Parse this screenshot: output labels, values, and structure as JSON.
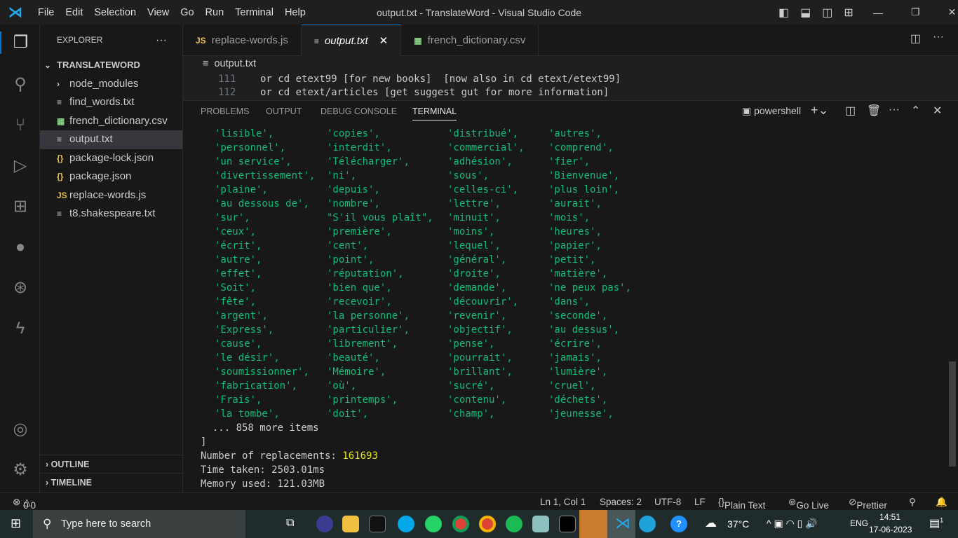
{
  "titlebar": {
    "menu": [
      "File",
      "Edit",
      "Selection",
      "View",
      "Go",
      "Run",
      "Terminal",
      "Help"
    ],
    "title": "output.txt - TranslateWord - Visual Studio Code"
  },
  "sidebar": {
    "header": "EXPLORER",
    "more": "···",
    "root": "TRANSLATEWORD",
    "items": [
      {
        "icon": "›",
        "label": "node_modules",
        "type": "folder"
      },
      {
        "icon": "≡",
        "label": "find_words.txt",
        "type": "txt"
      },
      {
        "icon": "▦",
        "label": "french_dictionary.csv",
        "type": "csv"
      },
      {
        "icon": "≡",
        "label": "output.txt",
        "type": "txt",
        "selected": true
      },
      {
        "icon": "{}",
        "label": "package-lock.json",
        "type": "json"
      },
      {
        "icon": "{}",
        "label": "package.json",
        "type": "json"
      },
      {
        "icon": "JS",
        "label": "replace-words.js",
        "type": "js"
      },
      {
        "icon": "≡",
        "label": "t8.shakespeare.txt",
        "type": "txt"
      }
    ],
    "outline": "OUTLINE",
    "timeline": "TIMELINE"
  },
  "tabs": [
    {
      "icon": "JS",
      "label": "replace-words.js"
    },
    {
      "icon": "≡",
      "label": "output.txt",
      "active": true,
      "close": "✕"
    },
    {
      "icon": "▦",
      "label": "french_dictionary.csv"
    }
  ],
  "breadcrumb": "output.txt",
  "editor": {
    "lines": [
      {
        "n": "111",
        "text": "or cd etext99 [for new books]  [now also in cd etext/etext99]"
      },
      {
        "n": "112",
        "text": "or cd etext/articles [get suggest gut for more information]"
      }
    ]
  },
  "panel": {
    "tabs": [
      "PROBLEMS",
      "OUTPUT",
      "DEBUG CONSOLE",
      "TERMINAL"
    ],
    "shell": "powershell"
  },
  "terminal": {
    "rows": [
      [
        "'lisible',",
        "'copies',",
        "'distribué',",
        "'autres',"
      ],
      [
        "'personnel',",
        "'interdit',",
        "'commercial',",
        "'comprend',"
      ],
      [
        "'un service',",
        "'Télécharger',",
        "'adhésion',",
        "'fier',"
      ],
      [
        "'divertissement',",
        "'ni',",
        "'sous',",
        "'Bienvenue',"
      ],
      [
        "'plaine',",
        "'depuis',",
        "'celles-ci',",
        "'plus loin',"
      ],
      [
        "'au dessous de',",
        "'nombre',",
        "'lettre',",
        "'aurait',"
      ],
      [
        "'sur',",
        "\"S'il vous plaît\",",
        "'minuit',",
        "'mois',"
      ],
      [
        "'ceux',",
        "'première',",
        "'moins',",
        "'heures',"
      ],
      [
        "'écrit',",
        "'cent',",
        "'lequel',",
        "'papier',"
      ],
      [
        "'autre',",
        "'point',",
        "'général',",
        "'petit',"
      ],
      [
        "'effet',",
        "'réputation',",
        "'droite',",
        "'matière',"
      ],
      [
        "'Soit',",
        "'bien que',",
        "'demande',",
        "'ne peux pas',"
      ],
      [
        "'fête',",
        "'recevoir',",
        "'découvrir',",
        "'dans',"
      ],
      [
        "'argent',",
        "'la personne',",
        "'revenir',",
        "'seconde',"
      ],
      [
        "'Express',",
        "'particulier',",
        "'objectif',",
        "'au dessus',"
      ],
      [
        "'cause',",
        "'librement',",
        "'pense',",
        "'écrire',"
      ],
      [
        "'le désir',",
        "'beauté',",
        "'pourrait',",
        "'jamais',"
      ],
      [
        "'soumissionner',",
        "'Mémoire',",
        "'brillant',",
        "'lumière',"
      ],
      [
        "'fabrication',",
        "'où',",
        "'sucré',",
        "'cruel',"
      ],
      [
        "'Frais',",
        "'printemps',",
        "'contenu',",
        "'déchets',"
      ],
      [
        "'la tombe',",
        "'doit',",
        "'champ',",
        "'jeunesse',"
      ]
    ],
    "more": "  ... 858 more items",
    "close_bracket": "]",
    "replacements_label": "Number of replacements: ",
    "replacements": "161693",
    "time": "Time taken: 2503.01ms",
    "memory": "Memory used: 121.03MB"
  },
  "status": {
    "errors": "0",
    "warnings": "0",
    "position": "Ln 1, Col 1",
    "spaces": "Spaces: 2",
    "encoding": "UTF-8",
    "eol": "LF",
    "language": "Plain Text",
    "golive": "Go Live",
    "prettier": "Prettier"
  },
  "taskbar": {
    "search_placeholder": "Type here to search",
    "weather": "37°C",
    "lang": "ENG",
    "time": "14:51",
    "date": "17-06-2023",
    "notif_count": "1"
  }
}
